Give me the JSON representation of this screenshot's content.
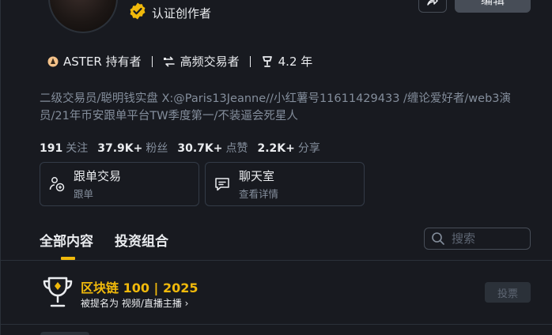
{
  "profile": {
    "creator_label": "认证创作者",
    "edit_label": "编辑"
  },
  "badges": [
    {
      "label": "ASTER 持有者",
      "icon": "aster-logo-icon"
    },
    {
      "label": "高频交易者",
      "icon": "swap-icon"
    },
    {
      "label": "4.2 年",
      "icon": "trophy-cup-icon"
    }
  ],
  "bio": "二级交易员/聪明钱实盘 X:@Paris13Jeanne//小红薯号11611429433 /缠论爱好者/web3演员/21年币安跟单平台TW季度第一/不装逼会死星人",
  "stats": [
    {
      "value": "191",
      "label": "关注"
    },
    {
      "value": "37.9K+",
      "label": "粉丝"
    },
    {
      "value": "30.7K+",
      "label": "点赞"
    },
    {
      "value": "2.2K+",
      "label": "分享"
    }
  ],
  "cards": [
    {
      "title": "跟单交易",
      "subtitle": "跟单",
      "icon": "copy-trade-icon"
    },
    {
      "title": "聊天室",
      "subtitle": "查看详情",
      "icon": "chat-icon"
    }
  ],
  "tabs": [
    {
      "label": "全部内容",
      "active": true
    },
    {
      "label": "投资组合",
      "active": false
    }
  ],
  "search": {
    "placeholder": "搜索"
  },
  "award": {
    "title": "区块链 100 | 2025",
    "subtitle": "被提名为 视频/直播主播 ›",
    "vote_label": "投票"
  },
  "colors": {
    "accent": "#f0b90b",
    "background": "#181a20",
    "muted": "#848e9c"
  }
}
